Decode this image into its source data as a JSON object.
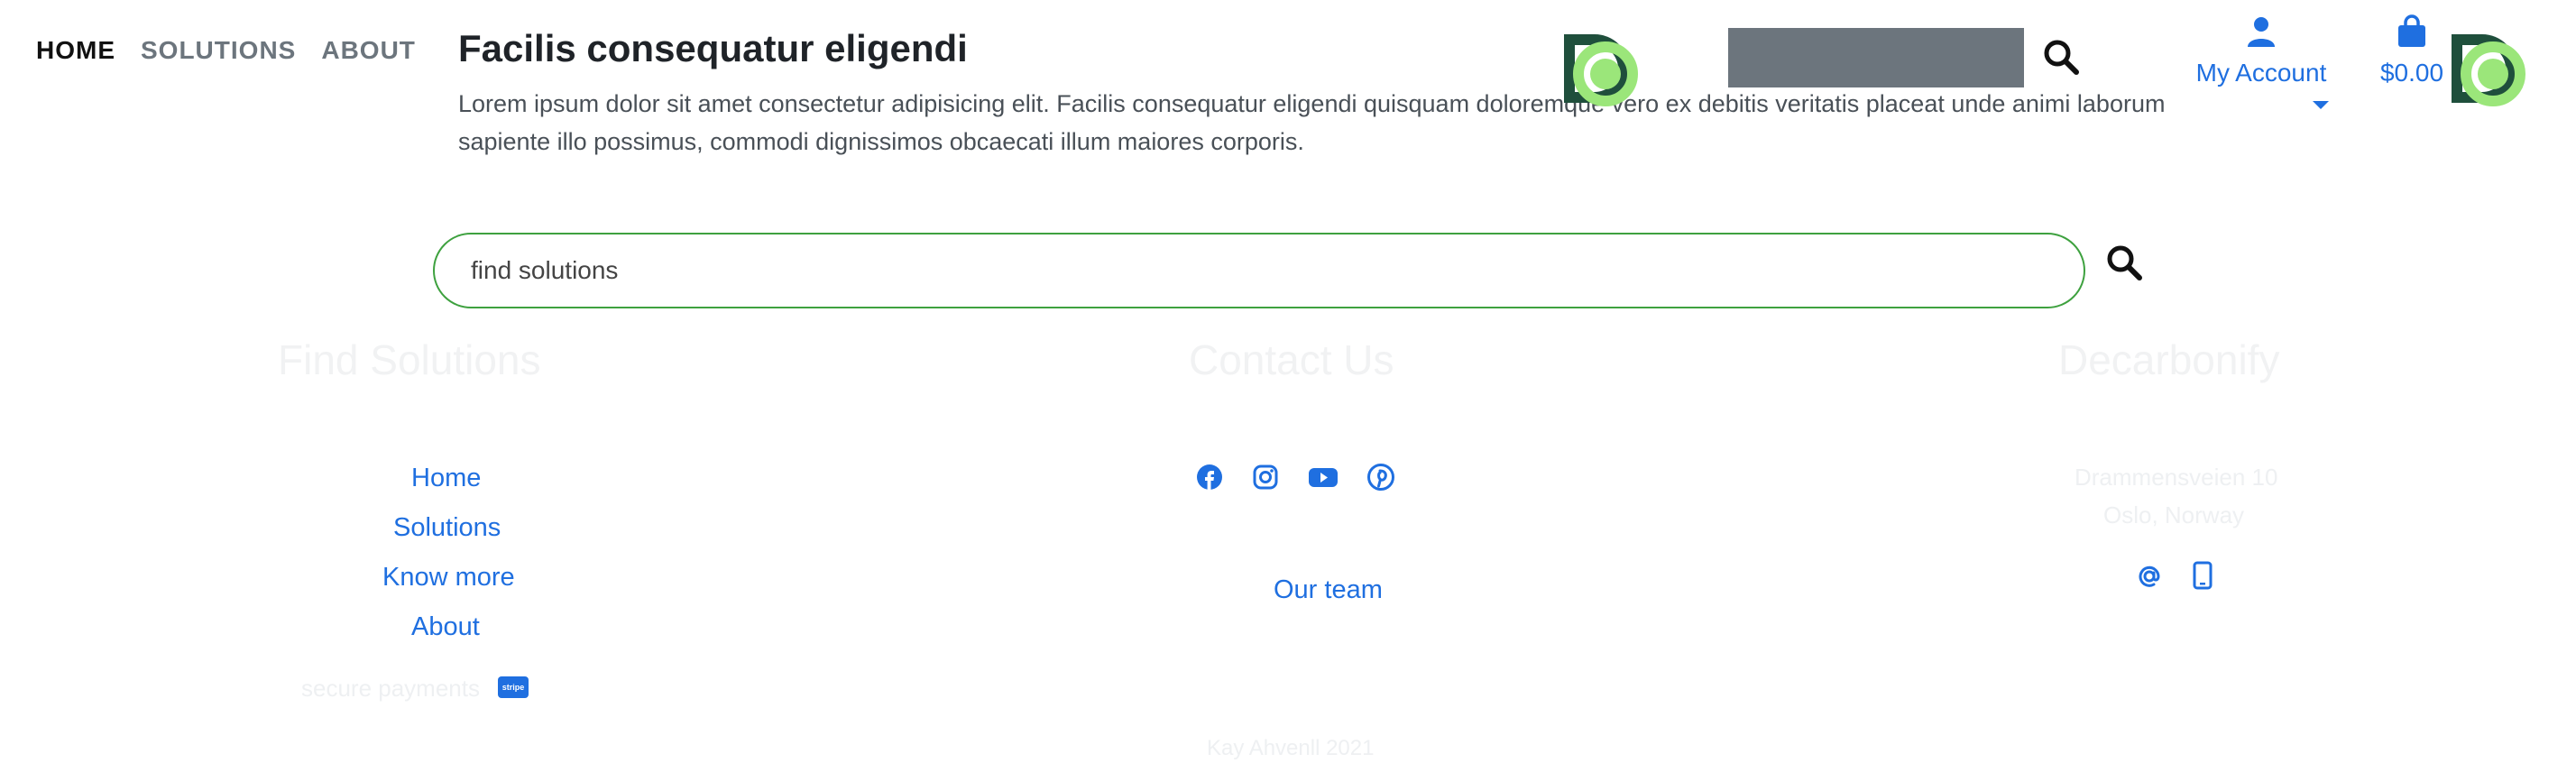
{
  "nav": {
    "home": "HOME",
    "solutions": "SOLUTIONS",
    "about": "ABOUT"
  },
  "hero": {
    "title": "Facilis consequatur eligendi",
    "lead": "Lorem ipsum dolor sit amet consectetur adipisicing elit. Facilis consequatur eligendi quisquam doloremque vero ex debitis veritatis placeat unde animi laborum sapiente illo possimus, commodi dignissimos obcaecati illum maiores corporis."
  },
  "header": {
    "account_label": "My Account",
    "cart_label": "$0.00"
  },
  "search": {
    "value": "find solutions"
  },
  "footer": {
    "col1_title": "Find Solutions",
    "col2_title": "Contact Us",
    "col3_title": "Decarbonify",
    "links": [
      "Home",
      "Solutions",
      "Know more",
      "About"
    ],
    "secure_payments": "secure payments",
    "stripe_badge": "stripe",
    "our_team": "Our team",
    "address_line1": "Drammensveien 10",
    "address_line2": "Oslo, Norway",
    "copyright": "Kay Ahvenll 2021"
  },
  "colors": {
    "accent": "#1f6fe0",
    "brand_green": "#3ea13f",
    "logo_dark": "#1f4f3c",
    "logo_light": "#9be67a"
  }
}
